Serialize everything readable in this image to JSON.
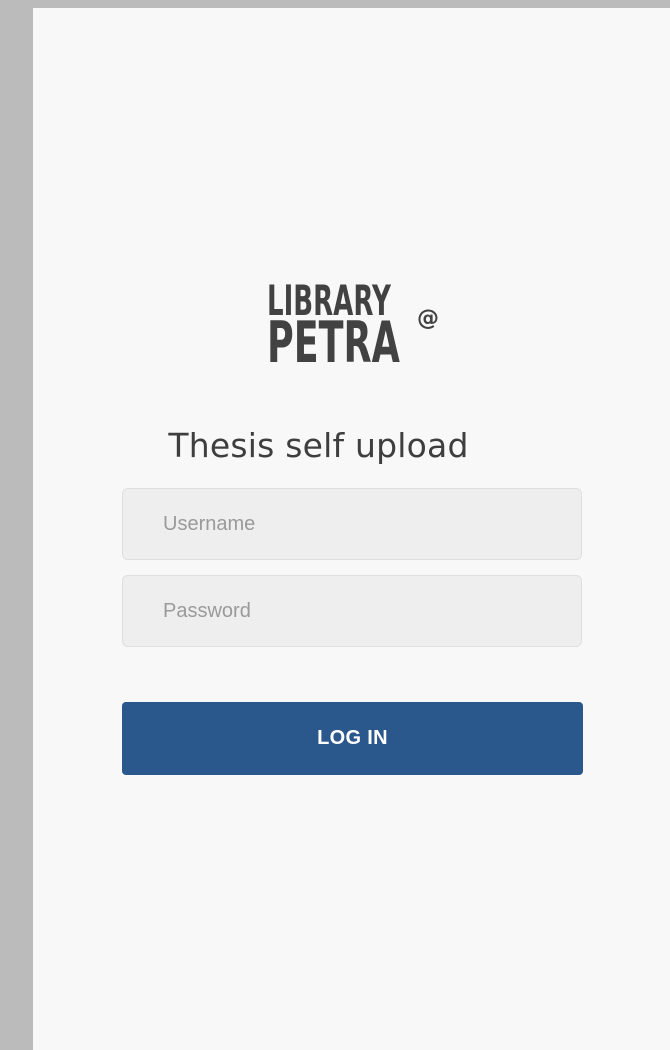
{
  "logo": {
    "line1": "LIBRARY",
    "line2": "PETRA",
    "at_symbol": "@"
  },
  "page": {
    "subtitle": "Thesis self upload"
  },
  "form": {
    "username_placeholder": "Username",
    "password_placeholder": "Password",
    "login_label": "LOG IN"
  },
  "colors": {
    "outer_background": "#bcbbbc",
    "page_background": "#f8f8f8",
    "input_background": "#eeeeee",
    "button_background": "#2a578c",
    "button_text": "#ffffff",
    "logo_text": "#424242"
  }
}
